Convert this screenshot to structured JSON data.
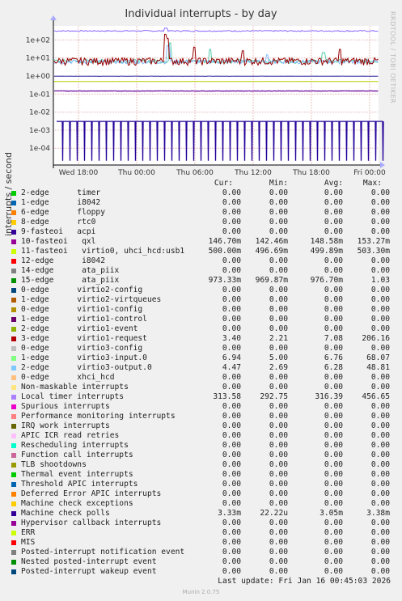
{
  "title": "Individual interrupts - by day",
  "side_label": "RRDTOOL / TOBI OETIKER",
  "chart_data": {
    "type": "line",
    "title": "Individual interrupts - by day",
    "ylabel": "interrupts / second",
    "yscale": "log",
    "yticks": [
      "1e+02",
      "1e+01",
      "1e+00",
      "1e-01",
      "1e-02",
      "1e-03",
      "1e-04"
    ],
    "xticks": [
      "Wed 18:00",
      "Thu 00:00",
      "Thu 06:00",
      "Thu 12:00",
      "Thu 18:00",
      "Fri 00:00"
    ],
    "series": [
      {
        "name": "Local timer interrupts",
        "color": "#8866ff",
        "avg": 316.39
      },
      {
        "name": "virtio1-request",
        "color": "#990000",
        "avg": 7.08
      },
      {
        "name": "virtio3-input.0",
        "color": "#55ccaa",
        "avg": 6.76
      },
      {
        "name": "virtio3-output.0",
        "color": "#88bbff",
        "avg": 6.28
      },
      {
        "name": "11-fasteoi virtio0, uhci_hcd:usb1",
        "color": "#888800",
        "avg": 0.49989
      },
      {
        "name": "10-fasteoi qxl",
        "color": "#660099",
        "avg": 0.14858
      },
      {
        "name": "15-edge ata_piix",
        "color": "#2a2aa0",
        "avg": 0.9767
      },
      {
        "name": "Machine check polls",
        "color": "#220099",
        "avg": 0.00305
      }
    ]
  },
  "legend_header": {
    "cur": "Cur:",
    "min": "Min:",
    "avg": "Avg:",
    "max": "Max:"
  },
  "legend": [
    {
      "name": "2-edge      timer",
      "color": "#00cc00",
      "cur": "0.00",
      "min": "0.00",
      "avg": "0.00",
      "max": "0.00"
    },
    {
      "name": "1-edge      i8042",
      "color": "#0066b3",
      "cur": "0.00",
      "min": "0.00",
      "avg": "0.00",
      "max": "0.00"
    },
    {
      "name": "6-edge      floppy",
      "color": "#ff8000",
      "cur": "0.00",
      "min": "0.00",
      "avg": "0.00",
      "max": "0.00"
    },
    {
      "name": "8-edge      rtc0",
      "color": "#ffcc00",
      "cur": "0.00",
      "min": "0.00",
      "avg": "0.00",
      "max": "0.00"
    },
    {
      "name": "9-fasteoi   acpi",
      "color": "#330099",
      "cur": "0.00",
      "min": "0.00",
      "avg": "0.00",
      "max": "0.00"
    },
    {
      "name": "10-fasteoi   qxl",
      "color": "#990099",
      "cur": "146.70m",
      "min": "142.46m",
      "avg": "148.58m",
      "max": "153.27m"
    },
    {
      "name": "11-fasteoi   virtio0, uhci_hcd:usb1",
      "color": "#ccff00",
      "cur": "500.00m",
      "min": "496.69m",
      "avg": "499.89m",
      "max": "503.30m"
    },
    {
      "name": "12-edge      i8042",
      "color": "#ff0000",
      "cur": "0.00",
      "min": "0.00",
      "avg": "0.00",
      "max": "0.00"
    },
    {
      "name": "14-edge      ata_piix",
      "color": "#808080",
      "cur": "0.00",
      "min": "0.00",
      "avg": "0.00",
      "max": "0.00"
    },
    {
      "name": "15-edge      ata_piix",
      "color": "#008f00",
      "cur": "973.33m",
      "min": "969.87m",
      "avg": "976.70m",
      "max": "1.03"
    },
    {
      "name": "0-edge      virtio2-config",
      "color": "#00487d",
      "cur": "0.00",
      "min": "0.00",
      "avg": "0.00",
      "max": "0.00"
    },
    {
      "name": "1-edge      virtio2-virtqueues",
      "color": "#b35a00",
      "cur": "0.00",
      "min": "0.00",
      "avg": "0.00",
      "max": "0.00"
    },
    {
      "name": "0-edge      virtio1-config",
      "color": "#b38f00",
      "cur": "0.00",
      "min": "0.00",
      "avg": "0.00",
      "max": "0.00"
    },
    {
      "name": "1-edge      virtio1-control",
      "color": "#6b006b",
      "cur": "0.00",
      "min": "0.00",
      "avg": "0.00",
      "max": "0.00"
    },
    {
      "name": "2-edge      virtio1-event",
      "color": "#8fb300",
      "cur": "0.00",
      "min": "0.00",
      "avg": "0.00",
      "max": "0.00"
    },
    {
      "name": "3-edge      virtio1-request",
      "color": "#b30000",
      "cur": "3.40",
      "min": "2.21",
      "avg": "7.08",
      "max": "206.16"
    },
    {
      "name": "0-edge      virtio3-config",
      "color": "#bebebe",
      "cur": "0.00",
      "min": "0.00",
      "avg": "0.00",
      "max": "0.00"
    },
    {
      "name": "1-edge      virtio3-input.0",
      "color": "#80ff80",
      "cur": "6.94",
      "min": "5.00",
      "avg": "6.76",
      "max": "68.07"
    },
    {
      "name": "2-edge      virtio3-output.0",
      "color": "#80c9ff",
      "cur": "4.47",
      "min": "2.69",
      "avg": "6.28",
      "max": "48.81"
    },
    {
      "name": "0-edge      xhci_hcd",
      "color": "#ffc080",
      "cur": "0.00",
      "min": "0.00",
      "avg": "0.00",
      "max": "0.00"
    },
    {
      "name": "Non-maskable interrupts",
      "color": "#ffe680",
      "cur": "0.00",
      "min": "0.00",
      "avg": "0.00",
      "max": "0.00"
    },
    {
      "name": "Local timer interrupts",
      "color": "#aa80ff",
      "cur": "313.58",
      "min": "292.75",
      "avg": "316.39",
      "max": "456.65"
    },
    {
      "name": "Spurious interrupts",
      "color": "#ee00cc",
      "cur": "0.00",
      "min": "0.00",
      "avg": "0.00",
      "max": "0.00"
    },
    {
      "name": "Performance monitoring interrupts",
      "color": "#ff8080",
      "cur": "0.00",
      "min": "0.00",
      "avg": "0.00",
      "max": "0.00"
    },
    {
      "name": "IRQ work interrupts",
      "color": "#666600",
      "cur": "0.00",
      "min": "0.00",
      "avg": "0.00",
      "max": "0.00"
    },
    {
      "name": "APIC ICR read retries",
      "color": "#ffbfff",
      "cur": "0.00",
      "min": "0.00",
      "avg": "0.00",
      "max": "0.00"
    },
    {
      "name": "Rescheduling interrupts",
      "color": "#00ffcc",
      "cur": "0.00",
      "min": "0.00",
      "avg": "0.00",
      "max": "0.00"
    },
    {
      "name": "Function call interrupts",
      "color": "#cc6699",
      "cur": "0.00",
      "min": "0.00",
      "avg": "0.00",
      "max": "0.00"
    },
    {
      "name": "TLB shootdowns",
      "color": "#999900",
      "cur": "0.00",
      "min": "0.00",
      "avg": "0.00",
      "max": "0.00"
    },
    {
      "name": "Thermal event interrupts",
      "color": "#00cc00",
      "cur": "0.00",
      "min": "0.00",
      "avg": "0.00",
      "max": "0.00"
    },
    {
      "name": "Threshold APIC interrupts",
      "color": "#0066b3",
      "cur": "0.00",
      "min": "0.00",
      "avg": "0.00",
      "max": "0.00"
    },
    {
      "name": "Deferred Error APIC interrupts",
      "color": "#ff8000",
      "cur": "0.00",
      "min": "0.00",
      "avg": "0.00",
      "max": "0.00"
    },
    {
      "name": "Machine check exceptions",
      "color": "#ffcc00",
      "cur": "0.00",
      "min": "0.00",
      "avg": "0.00",
      "max": "0.00"
    },
    {
      "name": "Machine check polls",
      "color": "#330099",
      "cur": "3.33m",
      "min": "22.22u",
      "avg": "3.05m",
      "max": "3.38m"
    },
    {
      "name": "Hypervisor callback interrupts",
      "color": "#990099",
      "cur": "0.00",
      "min": "0.00",
      "avg": "0.00",
      "max": "0.00"
    },
    {
      "name": "ERR",
      "color": "#ccff00",
      "cur": "0.00",
      "min": "0.00",
      "avg": "0.00",
      "max": "0.00"
    },
    {
      "name": "MIS",
      "color": "#ff0000",
      "cur": "0.00",
      "min": "0.00",
      "avg": "0.00",
      "max": "0.00"
    },
    {
      "name": "Posted-interrupt notification event",
      "color": "#808080",
      "cur": "0.00",
      "min": "0.00",
      "avg": "0.00",
      "max": "0.00"
    },
    {
      "name": "Nested posted-interrupt event",
      "color": "#008f00",
      "cur": "0.00",
      "min": "0.00",
      "avg": "0.00",
      "max": "0.00"
    },
    {
      "name": "Posted-interrupt wakeup event",
      "color": "#00487d",
      "cur": "0.00",
      "min": "0.00",
      "avg": "0.00",
      "max": "0.00"
    }
  ],
  "last_update": "Last update: Fri Jan 16 00:45:03 2026",
  "footer": "Munin 2.0.75"
}
